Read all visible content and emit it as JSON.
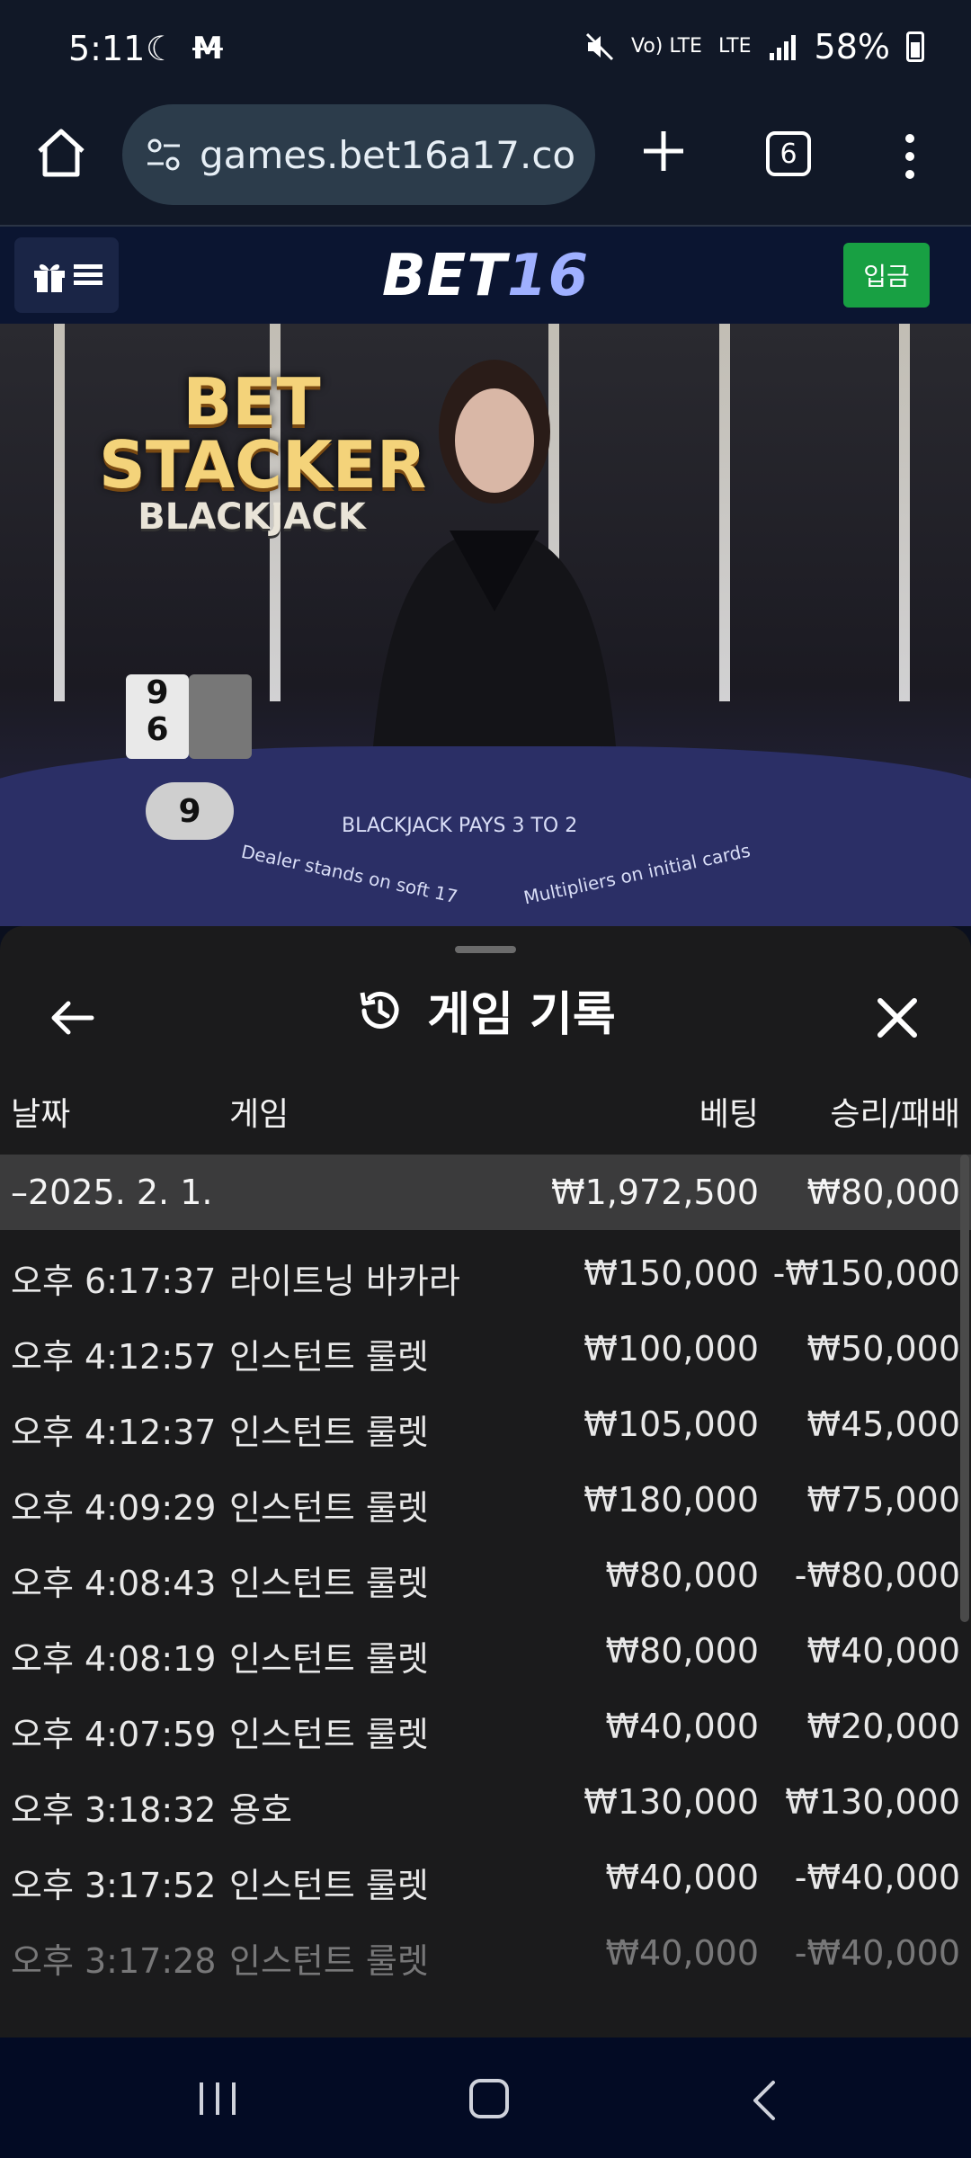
{
  "status_bar": {
    "time": "5:11",
    "volte": "Vo) LTE",
    "lte": "LTE",
    "battery": "58%"
  },
  "browser": {
    "url": "games.bet16a17.com",
    "tab_count": "6"
  },
  "site": {
    "brand_a": "BET",
    "brand_b": "16",
    "deposit_label": "입금"
  },
  "video": {
    "logo_line1": "BET",
    "logo_line2": "STACKER",
    "logo_line3": "BLACKJACK",
    "card_top": "9",
    "card_bottom": "6",
    "hand_score": "9",
    "table_text_main": "BLACKJACK PAYS 3 TO 2",
    "table_text_left": "Dealer stands on soft 17",
    "table_text_right": "Multipliers on initial cards"
  },
  "history": {
    "title": "게임 기록",
    "columns": {
      "date": "날짜",
      "game": "게임",
      "bet": "베팅",
      "win_loss": "승리/패배"
    },
    "summary": {
      "date": "–2025. 2. 1.",
      "bet": "₩1,972,500",
      "win": "₩80,000"
    },
    "rows": [
      {
        "time": "오후 6:17:37",
        "game": "라이트닝 바카라",
        "bet": "₩150,000",
        "win": "-₩150,000"
      },
      {
        "time": "오후 4:12:57",
        "game": "인스턴트 룰렛",
        "bet": "₩100,000",
        "win": "₩50,000"
      },
      {
        "time": "오후 4:12:37",
        "game": "인스턴트 룰렛",
        "bet": "₩105,000",
        "win": "₩45,000"
      },
      {
        "time": "오후 4:09:29",
        "game": "인스턴트 룰렛",
        "bet": "₩180,000",
        "win": "₩75,000"
      },
      {
        "time": "오후 4:08:43",
        "game": "인스턴트 룰렛",
        "bet": "₩80,000",
        "win": "-₩80,000"
      },
      {
        "time": "오후 4:08:19",
        "game": "인스턴트 룰렛",
        "bet": "₩80,000",
        "win": "₩40,000"
      },
      {
        "time": "오후 4:07:59",
        "game": "인스턴트 룰렛",
        "bet": "₩40,000",
        "win": "₩20,000"
      },
      {
        "time": "오후 3:18:32",
        "game": "용호",
        "bet": "₩130,000",
        "win": "₩130,000"
      },
      {
        "time": "오후 3:17:52",
        "game": "인스턴트 룰렛",
        "bet": "₩40,000",
        "win": "-₩40,000"
      },
      {
        "time": "오후 3:17:28",
        "game": "인스턴트 룰렛",
        "bet": "₩40,000",
        "win": "-₩40,000"
      }
    ]
  }
}
